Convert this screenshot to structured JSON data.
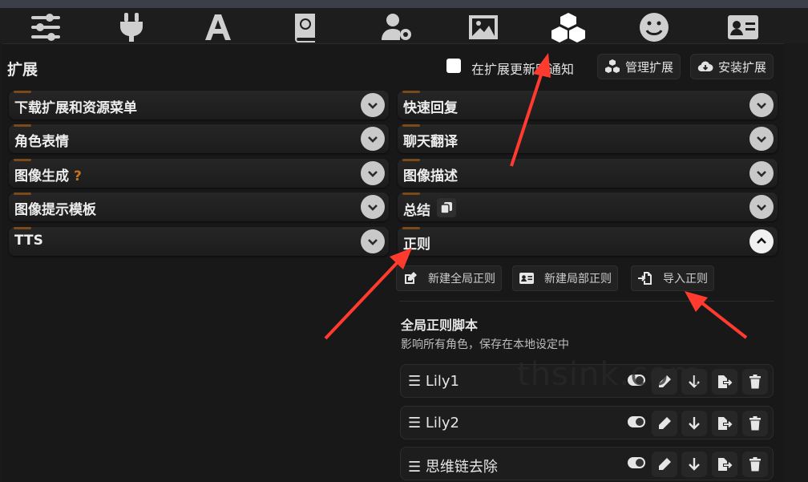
{
  "nav": {
    "icons": [
      "sliders-icon",
      "plug-icon",
      "font-icon",
      "book-atlas-icon",
      "user-gear-icon",
      "image-icon",
      "cubes-icon",
      "smile-icon",
      "id-card-icon"
    ]
  },
  "header": {
    "title": "扩展",
    "notify_label": "在扩展更新时通知",
    "notify_checked": false,
    "manage_label": "管理扩展",
    "install_label": "安装扩展"
  },
  "left_drawers": [
    {
      "label": "下载扩展和资源菜单"
    },
    {
      "label": "角色表情"
    },
    {
      "label": "图像生成",
      "hint": "?"
    },
    {
      "label": "图像提示模板"
    },
    {
      "label": "TTS"
    }
  ],
  "right_drawers": [
    {
      "label": "快速回复"
    },
    {
      "label": "聊天翻译"
    },
    {
      "label": "图像描述"
    },
    {
      "label": "总结"
    },
    {
      "label": "正则"
    }
  ],
  "regex": {
    "new_global": "新建全局正则",
    "new_local": "新建局部正则",
    "import": "导入正则",
    "section_title": "全局正则脚本",
    "section_sub": "影响所有角色，保存在本地设定中",
    "scripts": [
      {
        "name": "☰ Lily1"
      },
      {
        "name": "☰ Lily2"
      },
      {
        "name": "☰ 思维链去除"
      }
    ]
  },
  "watermark": "thsink.com",
  "colors": {
    "accent_orange": "#c7721c",
    "annotation_red": "#ff3b30"
  }
}
